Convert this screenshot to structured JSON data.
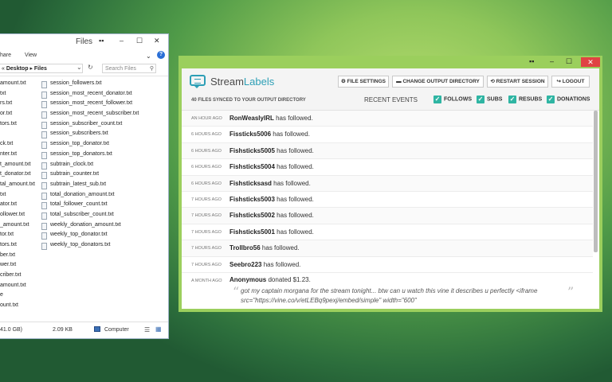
{
  "explorer": {
    "title": "Files",
    "ribbon": {
      "share": "hare",
      "view": "View"
    },
    "address": {
      "prefix": "«",
      "segment1": "Desktop",
      "segment2": "Files"
    },
    "search_placeholder": "Search Files",
    "left_files": [
      "amount.txt",
      "txt",
      "rs.txt",
      "or.txt",
      "tors.txt",
      "",
      "ck.txt",
      "nter.txt",
      "t_amount.txt",
      "t_donator.txt",
      "tal_amount.txt",
      "txt",
      "ator.txt",
      "ollower.txt",
      "_amount.txt",
      "tor.txt",
      "tors.txt",
      "ber.txt",
      "wer.txt",
      "criber.txt",
      "amount.txt",
      "e",
      "ount.txt"
    ],
    "files": [
      "session_followers.txt",
      "session_most_recent_donator.txt",
      "session_most_recent_follower.txt",
      "session_most_recent_subscriber.txt",
      "session_subscriber_count.txt",
      "session_subscribers.txt",
      "session_top_donator.txt",
      "session_top_donators.txt",
      "subtrain_clock.txt",
      "subtrain_counter.txt",
      "subtrain_latest_sub.txt",
      "total_donation_amount.txt",
      "total_follower_count.txt",
      "total_subscriber_count.txt",
      "weekly_donation_amount.txt",
      "weekly_top_donator.txt",
      "weekly_top_donators.txt"
    ],
    "status": {
      "free": "41.0 GB)",
      "size": "2.09 KB",
      "location": "Computer"
    }
  },
  "app": {
    "logo_stream": "Stream",
    "logo_labels": "Labels",
    "buttons": {
      "file_settings": "FILE SETTINGS",
      "change_output": "CHANGE OUTPUT DIRECTORY",
      "restart": "RESTART SESSION",
      "logout": "LOGOUT"
    },
    "synced_text": "40 FILES SYNCED TO YOUR OUTPUT DIRECTORY",
    "recent_events": "RECENT EVENTS",
    "filters": {
      "follows": "FOLLOWS",
      "subs": "SUBS",
      "resubs": "RESUBS",
      "donations": "DONATIONS"
    },
    "events": [
      {
        "time": "AN HOUR AGO",
        "name": "RonWeaslyIRL",
        "action": "has followed."
      },
      {
        "time": "6 HOURS AGO",
        "name": "Fissticks5006",
        "action": "has followed."
      },
      {
        "time": "6 HOURS AGO",
        "name": "Fishsticks5005",
        "action": "has followed."
      },
      {
        "time": "6 HOURS AGO",
        "name": "Fishsticks5004",
        "action": "has followed."
      },
      {
        "time": "6 HOURS AGO",
        "name": "Fishsticksasd",
        "action": "has followed."
      },
      {
        "time": "7 HOURS AGO",
        "name": "Fishsticks5003",
        "action": "has followed."
      },
      {
        "time": "7 HOURS AGO",
        "name": "Fishsticks5002",
        "action": "has followed."
      },
      {
        "time": "7 HOURS AGO",
        "name": "Fishsticks5001",
        "action": "has followed."
      },
      {
        "time": "7 HOURS AGO",
        "name": "Trollbro56",
        "action": "has followed."
      },
      {
        "time": "7 HOURS AGO",
        "name": "Seebro223",
        "action": "has followed."
      }
    ],
    "donation": {
      "time": "A MONTH AGO",
      "name": "Anonymous",
      "action": "donated $1.23.",
      "message": "got my captain morgana for the stream tonight... btw can u watch this vine it describes u perfectly <iframe src=\"https://vine.co/v/etLEBq9pexj/embed/simple\" width=\"600\""
    }
  },
  "colors": {
    "accent": "#2d9fb6",
    "checkbox": "#2fb5a3",
    "frame": "#9bcf5d",
    "close": "#e04343"
  }
}
